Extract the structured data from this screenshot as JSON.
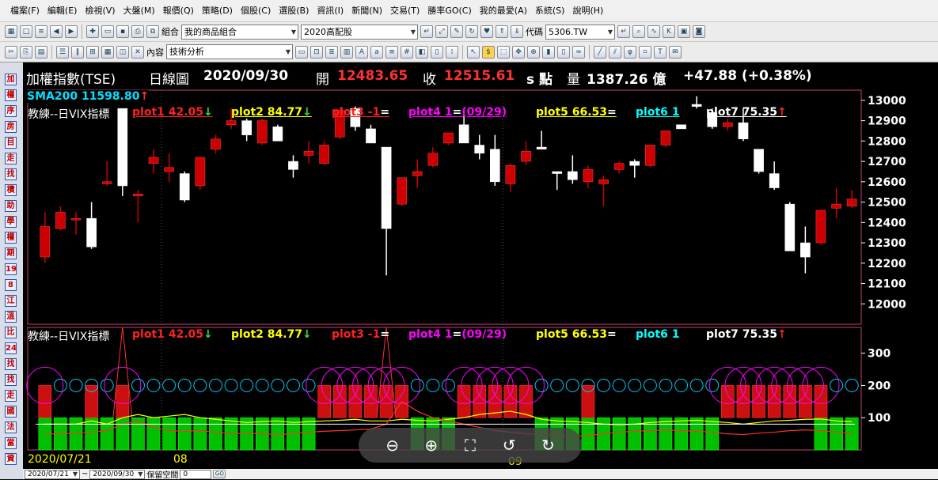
{
  "menu": [
    "檔案(F)",
    "編輯(E)",
    "檢視(V)",
    "大盤(M)",
    "報價(Q)",
    "策略(D)",
    "個股(C)",
    "選股(B)",
    "資訊(I)",
    "新聞(N)",
    "交易(T)",
    "勝率GO(C)",
    "我的最愛(A)",
    "系統(S)",
    "說明(H)"
  ],
  "toolbar1": {
    "combo_label": "組合",
    "combo_value": "我的商品組合",
    "list_value": "2020高配股",
    "code_label": "代碼",
    "code_value": "5306.TW"
  },
  "toolbar2": {
    "window_label": "內容",
    "window_value": "技術分析"
  },
  "sidebar": [
    "加",
    "權",
    "序",
    "房",
    "目",
    "走",
    "找",
    "積",
    "助",
    "學",
    "權",
    "期",
    "19",
    "8",
    "江",
    "溫",
    "比",
    "24",
    "找",
    "找",
    "走",
    "國",
    "法",
    "當",
    "資"
  ],
  "headline": {
    "name": "加權指數(TSE)",
    "period": "日線圖",
    "date": "2020/09/30",
    "open_label": "開",
    "open": "12483.65",
    "close_label": "收",
    "close": "12515.61",
    "unit_label": "s 點",
    "vol_label": "量",
    "volume": "1387.26 億",
    "change": "+47.88 (+0.38%)"
  },
  "main_legend": {
    "sma": "SMA200 11598.80",
    "sma_arrow": "↑",
    "indicator": "教練--日VIX指標"
  },
  "plots": [
    {
      "text": "plot1 42.05",
      "arrow": "↓",
      "color": "#ff2020",
      "arrow_color": "#30e030"
    },
    {
      "text": "plot2 84.77",
      "arrow": "↓",
      "color": "#ffff00",
      "arrow_color": "#30e030"
    },
    {
      "text": "plot3 -1",
      "arrow": "=",
      "color": "#ff2020",
      "arrow_color": "#ffffff"
    },
    {
      "text": "plot4 1",
      "arrow": "=",
      "extra": "(09/29)",
      "color": "#ff00ff",
      "arrow_color": "#ffffff"
    },
    {
      "text": "plot5 66.53",
      "arrow": "=",
      "color": "#ffff00",
      "arrow_color": "#ffffff"
    },
    {
      "text": "plot6 1",
      "arrow": "",
      "color": "#00ffff",
      "arrow_color": "#ffffff"
    },
    {
      "text": "plot7 75.35",
      "arrow": "↑",
      "color": "#ffffff",
      "arrow_color": "#ff2020"
    }
  ],
  "sub_legend": {
    "indicator": "教練--日VIX指標"
  },
  "xaxis": {
    "start_label": "2020/07/21",
    "month_labels": [
      "08",
      "09"
    ]
  },
  "statusbar": {
    "from": "2020/07/21",
    "tilde": "~",
    "to": "2020/09/30",
    "reserve_label": "保留空間",
    "reserve_value": "0",
    "go": "GO"
  },
  "colors": {
    "up": "#cc0000",
    "down": "#ffffff",
    "frame": "#c04070",
    "bar_green": "#00c000",
    "bar_red": "#cc1010",
    "circle_magenta": "#ff00ff",
    "circle_cyan": "#00c8ff"
  },
  "chart_data": [
    {
      "type": "candlestick",
      "yticks": [
        12000,
        12100,
        12200,
        12300,
        12400,
        12500,
        12600,
        12700,
        12800,
        12900,
        13000
      ],
      "ylim": [
        11900,
        13050
      ],
      "candles": [
        [
          12230,
          12450,
          12200,
          12380
        ],
        [
          12370,
          12480,
          12360,
          12450
        ],
        [
          12420,
          12450,
          12340,
          12420
        ],
        [
          12420,
          12500,
          12270,
          12280
        ],
        [
          12590,
          12700,
          12580,
          12600
        ],
        [
          12960,
          12960,
          12530,
          12580
        ],
        [
          12530,
          12560,
          12400,
          12540
        ],
        [
          12690,
          12760,
          12640,
          12720
        ],
        [
          12650,
          12740,
          12600,
          12670
        ],
        [
          12640,
          12650,
          12500,
          12510
        ],
        [
          12580,
          12710,
          12560,
          12720
        ],
        [
          12760,
          12830,
          12740,
          12810
        ],
        [
          12880,
          12960,
          12860,
          12900
        ],
        [
          12900,
          12910,
          12800,
          12830
        ],
        [
          12790,
          12910,
          12780,
          12900
        ],
        [
          12870,
          12880,
          12800,
          12800
        ],
        [
          12700,
          12730,
          12620,
          12660
        ],
        [
          12730,
          12800,
          12690,
          12750
        ],
        [
          12690,
          12800,
          12680,
          12780
        ],
        [
          12820,
          12960,
          12810,
          12950
        ],
        [
          12960,
          12970,
          12850,
          12870
        ],
        [
          12860,
          12880,
          12790,
          12790
        ],
        [
          12770,
          12770,
          12140,
          12370
        ],
        [
          12490,
          12620,
          12480,
          12620
        ],
        [
          12630,
          12710,
          12570,
          12650
        ],
        [
          12680,
          12770,
          12670,
          12740
        ],
        [
          12790,
          12840,
          12780,
          12840
        ],
        [
          12880,
          12960,
          12830,
          12790
        ],
        [
          12780,
          12830,
          12710,
          12740
        ],
        [
          12760,
          12830,
          12580,
          12600
        ],
        [
          12590,
          12690,
          12550,
          12680
        ],
        [
          12700,
          12800,
          12680,
          12750
        ],
        [
          12770,
          12850,
          12760,
          12760
        ],
        [
          12650,
          12650,
          12560,
          12640
        ],
        [
          12650,
          12730,
          12590,
          12610
        ],
        [
          12600,
          12680,
          12570,
          12660
        ],
        [
          12590,
          12630,
          12480,
          12610
        ],
        [
          12660,
          12700,
          12640,
          12690
        ],
        [
          12700,
          12710,
          12620,
          12680
        ],
        [
          12680,
          12780,
          12670,
          12780
        ],
        [
          12780,
          12850,
          12770,
          12850
        ],
        [
          12880,
          12880,
          12860,
          12860
        ],
        [
          12980,
          13020,
          12960,
          12970
        ],
        [
          12940,
          12960,
          12860,
          12870
        ],
        [
          12870,
          12910,
          12850,
          12890
        ],
        [
          12890,
          12960,
          12800,
          12810
        ],
        [
          12760,
          12760,
          12640,
          12650
        ],
        [
          12640,
          12700,
          12560,
          12570
        ],
        [
          12490,
          12500,
          12260,
          12260
        ],
        [
          12300,
          12380,
          12150,
          12230
        ],
        [
          12300,
          12460,
          12290,
          12460
        ],
        [
          12470,
          12570,
          12420,
          12490
        ],
        [
          12480,
          12560,
          12470,
          12515
        ]
      ]
    },
    {
      "type": "indicator",
      "yticks": [
        100,
        200,
        300
      ],
      "ylim": [
        0,
        380
      ],
      "plot2_line": [
        80,
        80,
        80,
        90,
        80,
        100,
        110,
        100,
        105,
        110,
        100,
        95,
        90,
        85,
        88,
        90,
        85,
        88,
        90,
        92,
        95,
        90,
        90,
        95,
        92,
        90,
        95,
        100,
        110,
        115,
        120,
        110,
        95,
        90,
        88,
        85,
        80,
        78,
        80,
        85,
        88,
        90,
        92,
        88,
        85,
        80,
        85,
        90,
        92,
        95,
        96,
        90,
        88
      ],
      "plot1_line": [
        50,
        50,
        52,
        55,
        60,
        80,
        90,
        70,
        60,
        58,
        60,
        55,
        50,
        52,
        50,
        48,
        50,
        55,
        58,
        60,
        62,
        65,
        80,
        150,
        120,
        100,
        90,
        80,
        70,
        60,
        55,
        50,
        48,
        45,
        42,
        45,
        50,
        55,
        58,
        60,
        62,
        60,
        58,
        55,
        50,
        48,
        52,
        55,
        60,
        62,
        60,
        55,
        50
      ],
      "green_bars": [
        1,
        1,
        1,
        1,
        1,
        1,
        1,
        1,
        1,
        1,
        1,
        1,
        1,
        1,
        1,
        1,
        1,
        1,
        0,
        0,
        0,
        0,
        0,
        0,
        1,
        1,
        1,
        0,
        0,
        0,
        0,
        0,
        1,
        1,
        1,
        1,
        1,
        1,
        1,
        1,
        1,
        1,
        1,
        1,
        0,
        0,
        0,
        0,
        0,
        0,
        1,
        1,
        1
      ],
      "red_bars": [
        1,
        0,
        0,
        1,
        0,
        1,
        0,
        0,
        0,
        0,
        0,
        0,
        0,
        0,
        0,
        0,
        0,
        0,
        1,
        1,
        1,
        1,
        1,
        1,
        0,
        0,
        0,
        1,
        1,
        1,
        1,
        1,
        0,
        0,
        0,
        1,
        0,
        0,
        0,
        0,
        0,
        0,
        0,
        0,
        1,
        1,
        1,
        1,
        1,
        1,
        1,
        0,
        0
      ],
      "magenta_circles": [
        1,
        0,
        0,
        0,
        0,
        1,
        0,
        0,
        0,
        0,
        0,
        0,
        0,
        0,
        0,
        0,
        0,
        0,
        1,
        1,
        1,
        1,
        1,
        1,
        0,
        0,
        0,
        1,
        1,
        1,
        1,
        1,
        0,
        0,
        0,
        0,
        0,
        0,
        0,
        0,
        0,
        0,
        0,
        0,
        1,
        1,
        1,
        1,
        1,
        1,
        1,
        0,
        0
      ],
      "spike_indices": [
        5,
        22
      ]
    }
  ]
}
